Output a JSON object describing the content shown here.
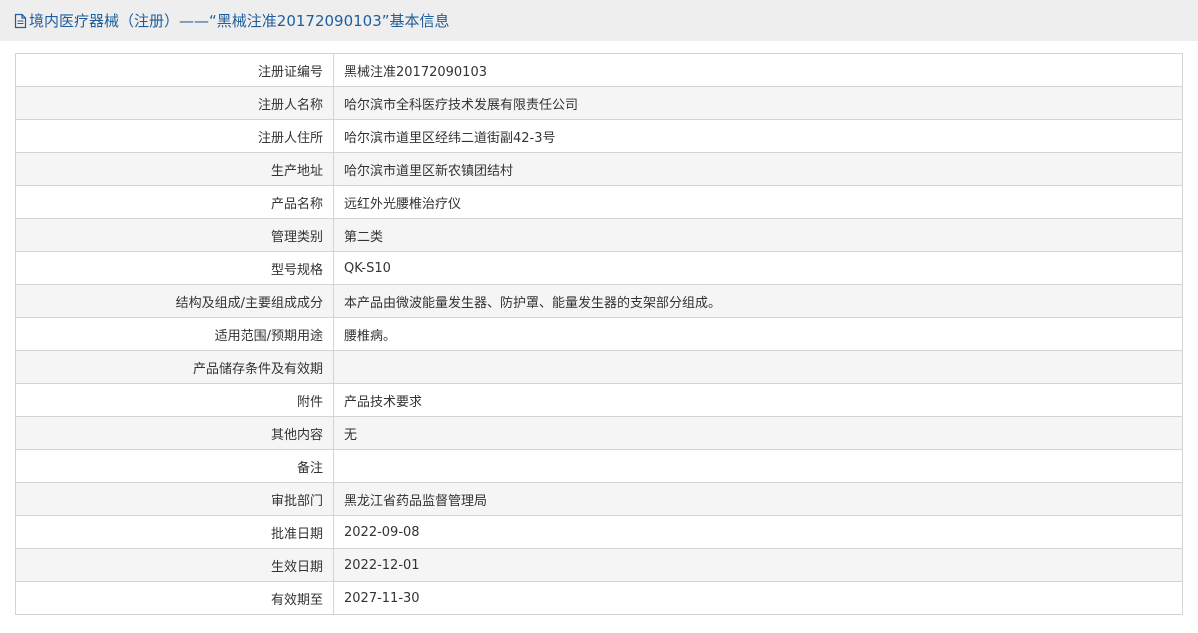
{
  "header": {
    "title": "境内医疗器械（注册）——“黑械注准20172090103”基本信息"
  },
  "rows": [
    {
      "label": "注册证编号",
      "value": "黑械注准20172090103"
    },
    {
      "label": "注册人名称",
      "value": "哈尔滨市全科医疗技术发展有限责任公司"
    },
    {
      "label": "注册人住所",
      "value": "哈尔滨市道里区经纬二道街副42-3号"
    },
    {
      "label": "生产地址",
      "value": "哈尔滨市道里区新农镇团结村"
    },
    {
      "label": "产品名称",
      "value": "远红外光腰椎治疗仪"
    },
    {
      "label": "管理类别",
      "value": "第二类"
    },
    {
      "label": "型号规格",
      "value": "QK-S10"
    },
    {
      "label": "结构及组成/主要组成成分",
      "value": "本产品由微波能量发生器、防护罩、能量发生器的支架部分组成。"
    },
    {
      "label": "适用范围/预期用途",
      "value": "腰椎病。"
    },
    {
      "label": "产品储存条件及有效期",
      "value": ""
    },
    {
      "label": "附件",
      "value": "产品技术要求"
    },
    {
      "label": "其他内容",
      "value": "无"
    },
    {
      "label": "备注",
      "value": ""
    },
    {
      "label": "审批部门",
      "value": "黑龙江省药品监督管理局"
    },
    {
      "label": "批准日期",
      "value": "2022-09-08"
    },
    {
      "label": "生效日期",
      "value": "2022-12-01"
    },
    {
      "label": "有效期至",
      "value": "2027-11-30"
    }
  ],
  "colors": {
    "header_bg": "#eeeeee",
    "header_text": "#1f5e9c",
    "border": "#d4d4d4",
    "row_alt_bg": "#f5f5f5",
    "text": "#333333"
  },
  "icons": {
    "header_icon": "document-icon"
  }
}
